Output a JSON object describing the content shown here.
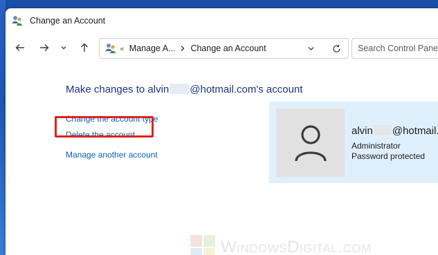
{
  "window": {
    "title": "Change an Account"
  },
  "navigation": {
    "address_overflow": "«",
    "breadcrumbs": [
      "Manage A...",
      "Change an Account"
    ],
    "search_placeholder": "Search Control Panel"
  },
  "main": {
    "heading_prefix": "Make changes to alvin",
    "heading_suffix": "@hotmail.com's account",
    "links": {
      "change_type": "Change the account type",
      "delete": "Delete the account",
      "manage_another": "Manage another account"
    }
  },
  "account_card": {
    "name_prefix": "alvin",
    "name_suffix": "@hotmail.",
    "role": "Administrator",
    "status": "Password protected"
  },
  "watermark": {
    "text": "WindowsDigital.com"
  },
  "colors": {
    "link": "#0d60b0",
    "heading": "#1e3287",
    "highlight": "#e02020",
    "card_bg": "#dff0fc"
  }
}
